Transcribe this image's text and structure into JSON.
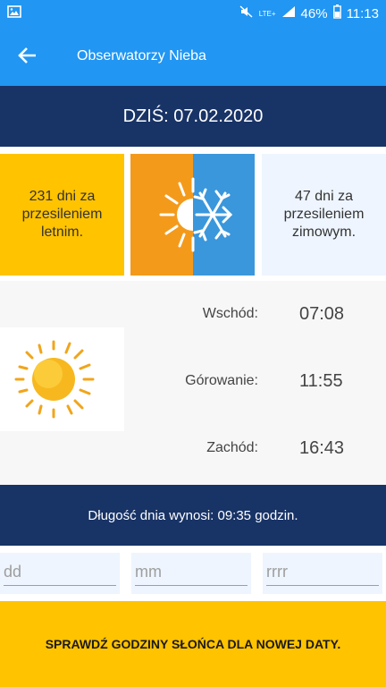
{
  "status": {
    "battery": "46%",
    "time": "11:13",
    "network": "LTE+"
  },
  "appbar": {
    "title": "Obserwatorzy Nieba"
  },
  "today": {
    "label": "DZIŚ: 07.02.2020"
  },
  "seasons": {
    "summer_text": "231 dni za przesileniem letnim.",
    "winter_text": "47 dni za przesileniem zimowym."
  },
  "sun_times": [
    {
      "label": "Wschód:",
      "value": "07:08"
    },
    {
      "label": "Górowanie:",
      "value": "11:55"
    },
    {
      "label": "Zachód:",
      "value": "16:43"
    }
  ],
  "day_length": {
    "text": "Długość dnia wynosi: 09:35 godzin."
  },
  "date_inputs": {
    "day_placeholder": "dd",
    "month_placeholder": "mm",
    "year_placeholder": "rrrr"
  },
  "action": {
    "check_label": "SPRAWDŹ GODZINY SŁOŃCA DLA NOWEJ DATY."
  },
  "colors": {
    "primary": "#2196f3",
    "dark": "#183366",
    "accent": "#ffc300",
    "winter": "#3a97dc",
    "summer": "#f49a1b"
  }
}
